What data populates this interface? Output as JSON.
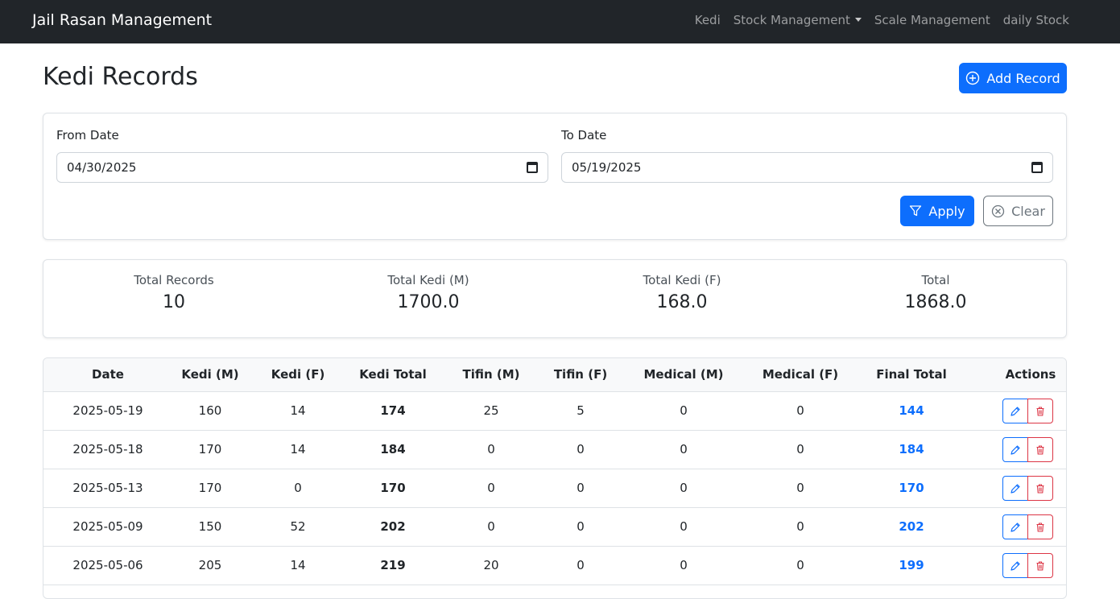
{
  "navbar": {
    "brand": "Jail Rasan Management",
    "links": [
      "Kedi",
      "Stock Management",
      "Scale Management",
      "daily Stock"
    ]
  },
  "page": {
    "title": "Kedi Records",
    "add_label": "Add Record"
  },
  "filter": {
    "from_label": "From Date",
    "from_value": "04/30/2025",
    "to_label": "To Date",
    "to_value": "05/19/2025",
    "apply_label": "Apply",
    "clear_label": "Clear"
  },
  "summary": [
    {
      "label": "Total Records",
      "value": "10"
    },
    {
      "label": "Total Kedi (M)",
      "value": "1700.0"
    },
    {
      "label": "Total Kedi (F)",
      "value": "168.0"
    },
    {
      "label": "Total",
      "value": "1868.0"
    }
  ],
  "table": {
    "headers": [
      "Date",
      "Kedi (M)",
      "Kedi (F)",
      "Kedi Total",
      "Tifin (M)",
      "Tifin (F)",
      "Medical (M)",
      "Medical (F)",
      "Final Total",
      "Actions"
    ],
    "rows": [
      [
        "2025-05-19",
        "160",
        "14",
        "174",
        "25",
        "5",
        "0",
        "0",
        "144"
      ],
      [
        "2025-05-18",
        "170",
        "14",
        "184",
        "0",
        "0",
        "0",
        "0",
        "184"
      ],
      [
        "2025-05-13",
        "170",
        "0",
        "170",
        "0",
        "0",
        "0",
        "0",
        "170"
      ],
      [
        "2025-05-09",
        "150",
        "52",
        "202",
        "0",
        "0",
        "0",
        "0",
        "202"
      ],
      [
        "2025-05-06",
        "205",
        "14",
        "219",
        "20",
        "0",
        "0",
        "0",
        "199"
      ]
    ]
  },
  "colors": {
    "navbar": "#212529",
    "primary": "#0d6efd",
    "danger": "#dc3545",
    "secondary": "#6c757d"
  },
  "icons": {
    "add": "plus-circle-icon",
    "apply": "filter-icon",
    "clear": "x-circle-icon",
    "edit": "pencil-icon",
    "delete": "trash-icon",
    "date": "calendar-icon"
  }
}
